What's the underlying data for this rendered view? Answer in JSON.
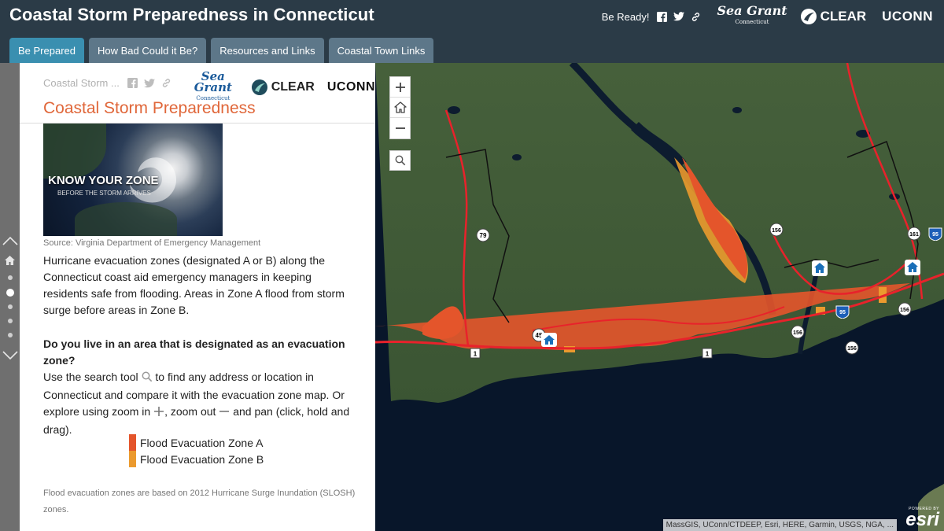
{
  "header": {
    "title": "Coastal Storm Preparedness in Connecticut",
    "be_ready": "Be Ready!",
    "logos": {
      "seagrant": "Sea Grant",
      "seagrant_sub": "Connecticut",
      "clear": "CLEAR",
      "uconn": "UCONN"
    }
  },
  "tabs": [
    {
      "label": "Be Prepared",
      "active": true
    },
    {
      "label": "How Bad Could it Be?",
      "active": false
    },
    {
      "label": "Resources and Links",
      "active": false
    },
    {
      "label": "Coastal Town Links",
      "active": false
    }
  ],
  "panel": {
    "mini_title": "Coastal Storm ...",
    "section_title": "Coastal Storm Preparedness",
    "hero": {
      "title": "KNOW YOUR ZONE",
      "subtitle": "BEFORE THE STORM ARRIVES"
    },
    "source": "Source: Virginia Department of Emergency Management",
    "paragraph1": "Hurricane evacuation zones (designated A or B) along the Connecticut coast aid emergency managers in keeping residents safe from flooding. Areas in Zone A flood from storm surge before areas in Zone B.",
    "question": "Do you live in an area that is designated as an evacuation zone?",
    "p2_a": "Use the search tool",
    "p2_b": "to find any address or location in Connecticut and compare it with the evacuation zone map. Or explore using zoom in",
    "p2_c": ", zoom out",
    "p2_d": "and pan (click, hold and drag).",
    "legend": [
      {
        "label": "Flood Evacuation Zone A",
        "color": "#e4552b"
      },
      {
        "label": "Flood Evacuation Zone B",
        "color": "#eb9a2e"
      }
    ],
    "footnote": "Flood evacuation zones are based on 2012 Hurricane Surge Inundation (SLOSH) zones."
  },
  "rail": {
    "active_index": 1
  },
  "map": {
    "attribution": "MassGIS, UConn/CTDEEP, Esri, HERE, Garmin, USGS, NGA, ...",
    "powered_by": "POWERED BY",
    "esri": "esri",
    "shields": [
      "79",
      "156",
      "161",
      "95",
      "45",
      "95",
      "156",
      "156",
      "156",
      "1",
      "1"
    ]
  }
}
